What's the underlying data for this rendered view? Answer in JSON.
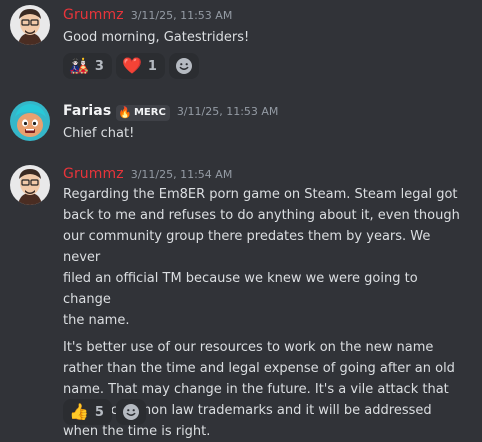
{
  "messages": [
    {
      "username": "Grummz",
      "timestamp": "3/11/25, 11:53 AM",
      "lines": [
        "Good morning, Gatestriders!"
      ],
      "reactions": [
        {
          "emoji": "🎎",
          "icon": "anime-girl-emoji",
          "count": "3"
        },
        {
          "emoji": "❤️",
          "icon": "heart-emoji",
          "count": "1"
        }
      ]
    },
    {
      "username": "Farias",
      "tag_icon": "🔥",
      "tag": "MERC",
      "timestamp": "3/11/25, 11:53 AM",
      "lines": [
        "Chief chat!"
      ]
    },
    {
      "username": "Grummz",
      "timestamp": "3/11/25, 11:54 AM",
      "lines": [
        "Regarding the Em8ER porn game on Steam. Steam legal got",
        "back to me and refuses to do anything about it, even though",
        "our community group there predates them by years. We never",
        "filed an official TM because we knew we were going to change",
        "the name.",
        "It's better use of our resources to work on the new name",
        "rather than the time and legal expense of going after an old",
        "name. That may change in the future. It's a vile attack that",
        "breaks common law trademarks and it will be addressed",
        "when the time is right."
      ],
      "reactions": [
        {
          "emoji": "👍",
          "icon": "thumbs-up-emoji",
          "count": "5"
        }
      ]
    }
  ],
  "colors": {
    "background": "#313338",
    "username_red": "#e8343a",
    "reaction_bg": "#2b2d31"
  }
}
